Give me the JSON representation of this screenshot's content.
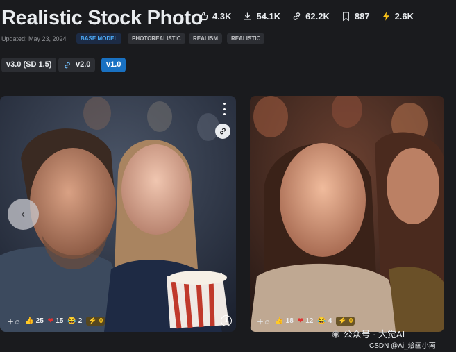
{
  "model": {
    "title": "Realistic Stock Photo",
    "updated": "Updated: May 23, 2024",
    "tags": [
      "BASE MODEL",
      "PHOTOREALISTIC",
      "REALISM",
      "REALISTIC"
    ]
  },
  "stats": [
    {
      "icon": "thumbs-up-icon",
      "value": "4.3K"
    },
    {
      "icon": "download-icon",
      "value": "54.1K"
    },
    {
      "icon": "link-icon",
      "value": "62.2K"
    },
    {
      "icon": "bookmark-icon",
      "value": "887"
    },
    {
      "icon": "bolt-icon",
      "value": "2.6K"
    }
  ],
  "versions": [
    {
      "label": "v3.0 (SD 1.5)",
      "active": false
    },
    {
      "label": "v2.0",
      "active": false,
      "icon": "link-icon"
    },
    {
      "label": "v1.0",
      "active": true
    }
  ],
  "cards": [
    {
      "thumbs": "25",
      "hearts": "15",
      "laugh": "2",
      "bolt": "0"
    },
    {
      "thumbs": "18",
      "hearts": "12",
      "laugh": "4",
      "bolt": "0"
    }
  ],
  "watermark": {
    "text": "公众号 · 大觉AI",
    "csdn": "CSDN @Ai_绘画小南"
  },
  "colors": {
    "background": "#1a1b1e",
    "accent": "#1971c2",
    "tag_base": "#4dabf7",
    "bolt": "#fcc419",
    "heart": "#e03131"
  }
}
